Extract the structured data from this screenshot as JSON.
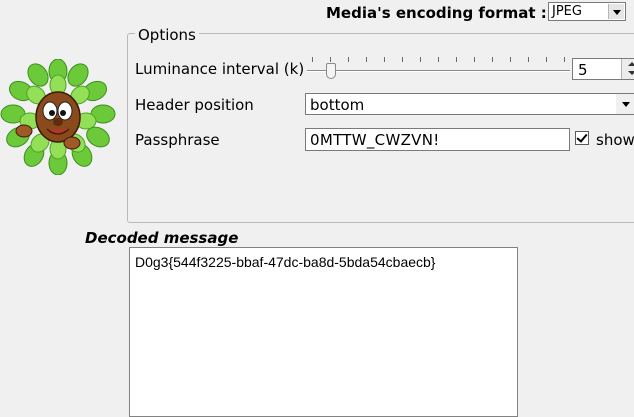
{
  "format": {
    "label": "Media's encoding format :",
    "value": "JPEG"
  },
  "options": {
    "group_title": "Options",
    "luminance": {
      "label": "Luminance interval (k)",
      "value": "5",
      "slider_fraction": 0.08
    },
    "header_position": {
      "label": "Header position",
      "value": "bottom"
    },
    "passphrase": {
      "label": "Passphrase",
      "value": "0MTTW_CWZVN!",
      "show_label": "show",
      "show_checked": true
    }
  },
  "decoded": {
    "label": "Decoded message",
    "text": "D0g3{544f3225-bbaf-47dc-ba8d-5bda54cbaecb}"
  },
  "icons": {
    "mascot": "leafy-mascot-icon",
    "format_arrow": "chevron-down-icon"
  },
  "colors": {
    "window_bg": "#f0f0f0",
    "field_bg": "#ffffff",
    "leaf_green": "#5fbf2a"
  }
}
